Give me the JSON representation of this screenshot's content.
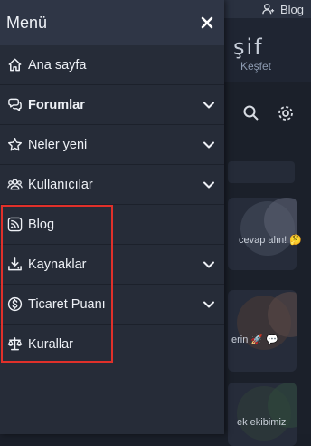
{
  "background": {
    "topbar_link": "Blog",
    "title": "şif",
    "subtitle": "Keşfet",
    "snippets": [
      "cevap alın! 🤔",
      "erin 🚀 💬",
      "ek ekibimiz"
    ]
  },
  "drawer": {
    "title": "Menü",
    "items": [
      {
        "label": "Ana sayfa",
        "icon": "home-icon"
      },
      {
        "label": "Forumlar",
        "icon": "comments-icon",
        "expandable": true
      },
      {
        "label": "Neler yeni",
        "icon": "star-icon",
        "expandable": true
      },
      {
        "label": "Kullanıcılar",
        "icon": "users-icon",
        "expandable": true
      },
      {
        "label": "Blog",
        "icon": "rss-icon"
      },
      {
        "label": "Kaynaklar",
        "icon": "download-icon",
        "expandable": true
      },
      {
        "label": "Ticaret Puanı",
        "icon": "dollar-icon",
        "expandable": true
      },
      {
        "label": "Kurallar",
        "icon": "scale-icon"
      }
    ]
  },
  "colors": {
    "drawer_bg": "#262c38",
    "header_bg": "#2f3646",
    "text": "#eef1f6",
    "highlight": "#e0302a"
  }
}
